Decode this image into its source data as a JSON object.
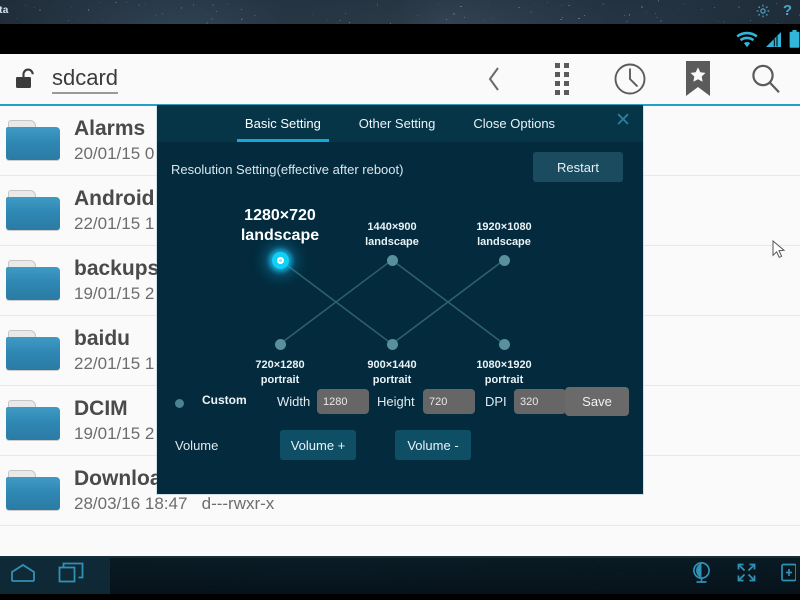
{
  "emulator": {
    "title": "Beta",
    "gear_icon": "gear-icon",
    "help_icon": "question-mark-icon",
    "statusbar": {
      "wifi_icon": "wifi-icon",
      "signal_icon": "signal-bars-icon",
      "battery_icon": "battery-icon"
    },
    "navbar": {
      "home_icon": "home-icon",
      "recents_icon": "recent-apps-icon",
      "camera_icon": "camera-icon",
      "fullscreen_icon": "fullscreen-icon",
      "apk_icon": "install-apk-icon"
    }
  },
  "filemanager": {
    "lock_icon": "unlocked-padlock-icon",
    "path": "sdcard",
    "actions": [
      {
        "name": "back-chevron-icon",
        "glyph": "‹"
      },
      {
        "name": "grid-view-icon",
        "glyph": ""
      },
      {
        "name": "clock-history-icon",
        "glyph": ""
      },
      {
        "name": "bookmark-star-icon",
        "glyph": ""
      },
      {
        "name": "search-icon",
        "glyph": ""
      }
    ],
    "files": [
      {
        "name": "Alarms",
        "meta": "20/01/15 0"
      },
      {
        "name": "Android",
        "meta": "22/01/15 1"
      },
      {
        "name": "backups",
        "meta": "19/01/15 2"
      },
      {
        "name": "baidu",
        "meta": "22/01/15 1"
      },
      {
        "name": "DCIM",
        "meta": "19/01/15 2"
      },
      {
        "name": "Download",
        "meta": "28/03/16 18:47   d---rwxr-x"
      }
    ]
  },
  "dialog": {
    "tabs": [
      {
        "label": "Basic Setting",
        "active": true
      },
      {
        "label": "Other Setting",
        "active": false
      },
      {
        "label": "Close Options",
        "active": false
      }
    ],
    "close_label": "✕",
    "resolution_heading": "Resolution Setting(effective after reboot)",
    "restart_label": "Restart",
    "resolutions": [
      {
        "id": "r1280x720",
        "size": "1280×720",
        "orientation": "landscape",
        "row": "top",
        "col": 0,
        "selected": true
      },
      {
        "id": "r1440x900",
        "size": "1440×900",
        "orientation": "landscape",
        "row": "top",
        "col": 1,
        "selected": false
      },
      {
        "id": "r1920x1080",
        "size": "1920×1080",
        "orientation": "landscape",
        "row": "top",
        "col": 2,
        "selected": false
      },
      {
        "id": "r720x1280",
        "size": "720×1280",
        "orientation": "portrait",
        "row": "bottom",
        "col": 0,
        "selected": false
      },
      {
        "id": "r900x1440",
        "size": "900×1440",
        "orientation": "portrait",
        "row": "bottom",
        "col": 1,
        "selected": false
      },
      {
        "id": "r1080x1920",
        "size": "1080×1920",
        "orientation": "portrait",
        "row": "bottom",
        "col": 2,
        "selected": false
      }
    ],
    "custom": {
      "radio_label": "Custom",
      "width_label": "Width",
      "width_value": "1280",
      "height_label": "Height",
      "height_value": "720",
      "dpi_label": "DPI",
      "dpi_value": "320",
      "save_label": "Save"
    },
    "volume": {
      "label": "Volume",
      "up_label": "Volume +",
      "down_label": "Volume -"
    }
  },
  "colors": {
    "dialog_bg": "#032b3d",
    "dialog_tabbar": "#063548",
    "accent": "#18a8d8",
    "selected_dot": "#0fd0f5",
    "dot": "#58909e",
    "restart_btn": "#1a4b5e",
    "volume_btn": "#0f4f66",
    "input_bg": "#666666",
    "save_btn": "#6a6a6a",
    "fm_bg": "#fafafa",
    "folder": "#2f88b4",
    "header_rule": "#23a0c8",
    "emu_icon": "#4aa8c8"
  }
}
